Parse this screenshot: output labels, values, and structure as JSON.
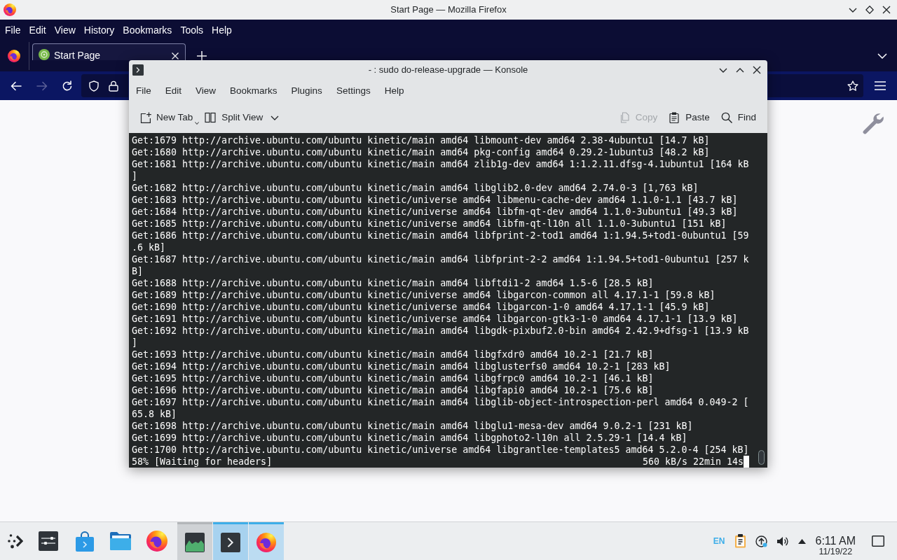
{
  "firefox": {
    "title": "Start Page — Mozilla Firefox",
    "menu": [
      "File",
      "Edit",
      "View",
      "History",
      "Bookmarks",
      "Tools",
      "Help"
    ],
    "tabs": [
      {
        "label": "Start Page",
        "selected": true
      }
    ],
    "navigation": [
      {
        "disabled": false
      },
      {
        "disabled": true
      },
      {
        "disabled": false
      }
    ]
  },
  "konsole": {
    "title": "- : sudo do-release-upgrade — Konsole",
    "menu": [
      "File",
      "Edit",
      "View",
      "Bookmarks",
      "Plugins",
      "Settings",
      "Help"
    ],
    "toolbar": [
      {
        "label": "New Tab",
        "disabled": false
      },
      {
        "label": "Split View",
        "disabled": false
      },
      {
        "label": "Copy",
        "disabled": true
      },
      {
        "label": "Paste",
        "disabled": false
      },
      {
        "label": "Find",
        "disabled": false
      }
    ],
    "lines": [
      "Get:1679 http://archive.ubuntu.com/ubuntu kinetic/main amd64 libmount-dev amd64 2.38-4ubuntu1 [14.7 kB]",
      "Get:1680 http://archive.ubuntu.com/ubuntu kinetic/main amd64 pkg-config amd64 0.29.2-1ubuntu3 [48.2 kB]",
      "Get:1681 http://archive.ubuntu.com/ubuntu kinetic/main amd64 zlib1g-dev amd64 1:1.2.11.dfsg-4.1ubuntu1 [164 kB",
      "]",
      "Get:1682 http://archive.ubuntu.com/ubuntu kinetic/main amd64 libglib2.0-dev amd64 2.74.0-3 [1,763 kB]",
      "Get:1683 http://archive.ubuntu.com/ubuntu kinetic/universe amd64 libmenu-cache-dev amd64 1.1.0-1.1 [43.7 kB]",
      "Get:1684 http://archive.ubuntu.com/ubuntu kinetic/universe amd64 libfm-qt-dev amd64 1.1.0-3ubuntu1 [49.3 kB]",
      "Get:1685 http://archive.ubuntu.com/ubuntu kinetic/universe amd64 libfm-qt-l10n all 1.1.0-3ubuntu1 [151 kB]",
      "Get:1686 http://archive.ubuntu.com/ubuntu kinetic/main amd64 libfprint-2-tod1 amd64 1:1.94.5+tod1-0ubuntu1 [59",
      ".6 kB]",
      "Get:1687 http://archive.ubuntu.com/ubuntu kinetic/main amd64 libfprint-2-2 amd64 1:1.94.5+tod1-0ubuntu1 [257 k",
      "B]",
      "Get:1688 http://archive.ubuntu.com/ubuntu kinetic/main amd64 libftdi1-2 amd64 1.5-6 [28.5 kB]",
      "Get:1689 http://archive.ubuntu.com/ubuntu kinetic/universe amd64 libgarcon-common all 4.17.1-1 [59.8 kB]",
      "Get:1690 http://archive.ubuntu.com/ubuntu kinetic/universe amd64 libgarcon-1-0 amd64 4.17.1-1 [45.9 kB]",
      "Get:1691 http://archive.ubuntu.com/ubuntu kinetic/universe amd64 libgarcon-gtk3-1-0 amd64 4.17.1-1 [13.9 kB]",
      "Get:1692 http://archive.ubuntu.com/ubuntu kinetic/main amd64 libgdk-pixbuf2.0-bin amd64 2.42.9+dfsg-1 [13.9 kB",
      "]",
      "Get:1693 http://archive.ubuntu.com/ubuntu kinetic/main amd64 libgfxdr0 amd64 10.2-1 [21.7 kB]",
      "Get:1694 http://archive.ubuntu.com/ubuntu kinetic/main amd64 libglusterfs0 amd64 10.2-1 [283 kB]",
      "Get:1695 http://archive.ubuntu.com/ubuntu kinetic/main amd64 libgfrpc0 amd64 10.2-1 [46.1 kB]",
      "Get:1696 http://archive.ubuntu.com/ubuntu kinetic/main amd64 libgfapi0 amd64 10.2-1 [75.6 kB]",
      "Get:1697 http://archive.ubuntu.com/ubuntu kinetic/main amd64 libglib-object-introspection-perl amd64 0.049-2 [",
      "65.8 kB]",
      "Get:1698 http://archive.ubuntu.com/ubuntu kinetic/main amd64 libglu1-mesa-dev amd64 9.0.2-1 [231 kB]",
      "Get:1699 http://archive.ubuntu.com/ubuntu kinetic/main amd64 libgphoto2-l10n all 2.5.29-1 [14.4 kB]",
      "Get:1700 http://archive.ubuntu.com/ubuntu kinetic/universe amd64 libgrantlee-templates5 amd64 5.2.0-4 [254 kB]"
    ],
    "status": "58% [Waiting for headers]",
    "rate": "560 kB/s 22min 14s"
  },
  "taskbar": {
    "tasks": [
      {
        "selected": false,
        "minimized": true
      },
      {
        "selected": true,
        "minimized": false
      },
      {
        "selected": false,
        "minimized": false
      }
    ],
    "language": "EN",
    "time": "6:11 AM",
    "date": "11/19/22"
  }
}
